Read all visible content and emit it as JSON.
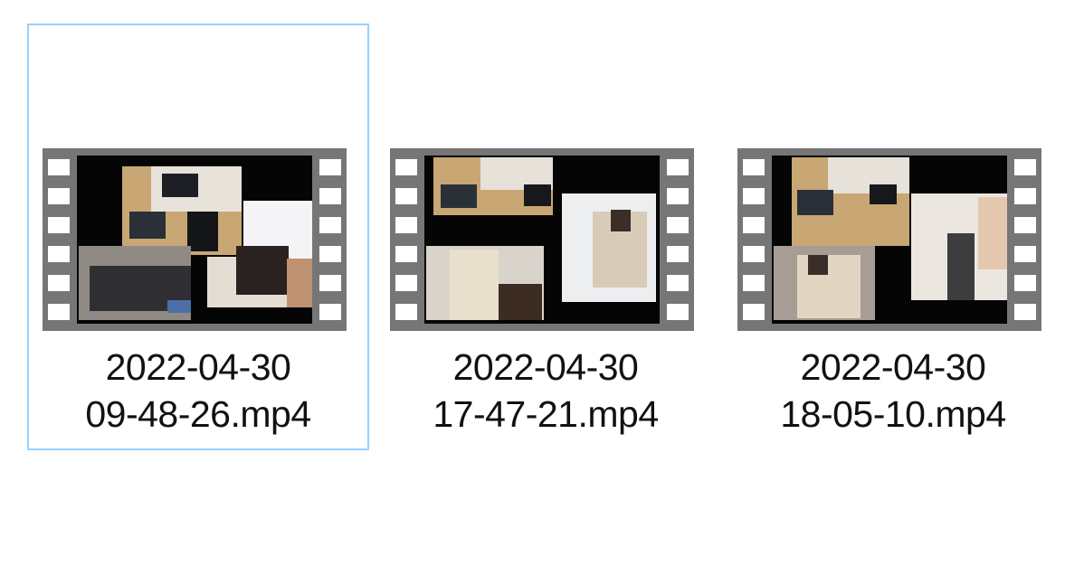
{
  "files": [
    {
      "name_line1": "2022-04-30",
      "name_line2": "09-48-26.mp4",
      "selected": true,
      "icon": "video-thumbnail-icon"
    },
    {
      "name_line1": "2022-04-30",
      "name_line2": "17-47-21.mp4",
      "selected": false,
      "icon": "video-thumbnail-icon"
    },
    {
      "name_line1": "2022-04-30",
      "name_line2": "18-05-10.mp4",
      "selected": false,
      "icon": "video-thumbnail-icon"
    }
  ],
  "colors": {
    "selection_border": "#99d1ff",
    "film_frame": "#767676",
    "film_hole": "#ffffff",
    "video_background": "#050505"
  }
}
